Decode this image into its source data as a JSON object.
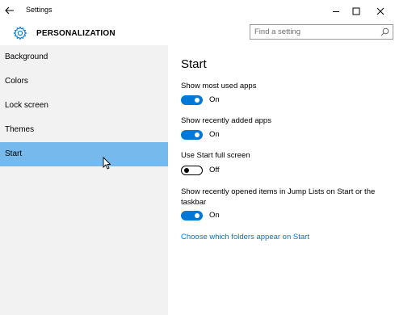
{
  "window": {
    "title": "Settings",
    "minimize_glyph": "–",
    "maximize_glyph": "□",
    "close_glyph": "×"
  },
  "header": {
    "section_title": "PERSONALIZATION",
    "search_placeholder": "Find a setting"
  },
  "sidebar": {
    "items": [
      {
        "label": "Background",
        "selected": false
      },
      {
        "label": "Colors",
        "selected": false
      },
      {
        "label": "Lock screen",
        "selected": false
      },
      {
        "label": "Themes",
        "selected": false
      },
      {
        "label": "Start",
        "selected": true
      }
    ]
  },
  "content": {
    "title": "Start",
    "settings": [
      {
        "label": "Show most used apps",
        "state": "On"
      },
      {
        "label": "Show recently added apps",
        "state": "On"
      },
      {
        "label": "Use Start full screen",
        "state": "Off"
      },
      {
        "label": "Show recently opened items in Jump Lists on Start or the taskbar",
        "state": "On"
      }
    ],
    "link": "Choose which folders appear on Start"
  },
  "colors": {
    "accent": "#0078d7",
    "selection": "#76b9ed",
    "sidebar_bg": "#f2f2f2"
  }
}
